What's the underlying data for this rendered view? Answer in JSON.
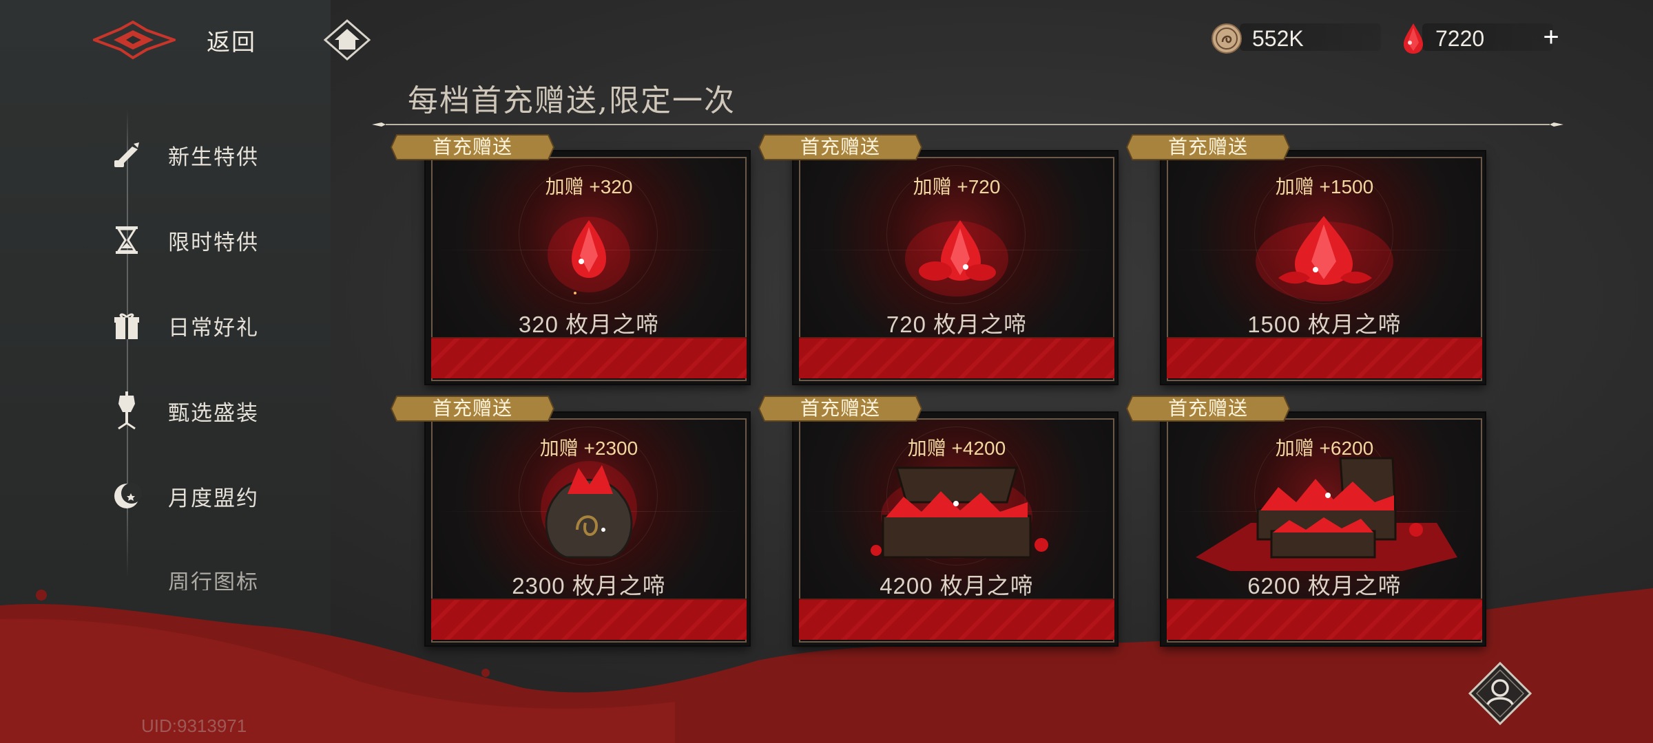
{
  "nav": {
    "back_label": "返回",
    "back_logo_icon": "winged-crest-icon",
    "home_icon": "home-diamond-icon"
  },
  "sidebar": {
    "items": [
      {
        "label": "新生特供",
        "icon": "scroll-quill-icon"
      },
      {
        "label": "限时特供",
        "icon": "hourglass-icon"
      },
      {
        "label": "日常好礼",
        "icon": "gift-box-icon"
      },
      {
        "label": "甄选盛装",
        "icon": "dress-form-icon"
      },
      {
        "label": "月度盟约",
        "icon": "crescent-moon-icon"
      },
      {
        "label": "周行图标",
        "icon": "partial-icon"
      }
    ],
    "uid": "UID:9313971"
  },
  "currencies": {
    "coin_value": "552K",
    "gem_value": "7220",
    "plus_label": "+"
  },
  "shop": {
    "heading": "每档首充赠送,限定一次",
    "ribbon_label": "首充赠送",
    "cards": [
      {
        "bonus": "加赠 +320",
        "amount": "320 枚月之啼",
        "art": "single-gem"
      },
      {
        "bonus": "加赠 +720",
        "amount": "720 枚月之啼",
        "art": "gem-cluster"
      },
      {
        "bonus": "加赠 +1500",
        "amount": "1500 枚月之啼",
        "art": "gem-pile"
      },
      {
        "bonus": "加赠 +2300",
        "amount": "2300 枚月之啼",
        "art": "gem-pouch"
      },
      {
        "bonus": "加赠 +4200",
        "amount": "4200 枚月之啼",
        "art": "gem-chest"
      },
      {
        "bonus": "加赠 +6200",
        "amount": "6200 枚月之啼",
        "art": "double-gem-chest"
      }
    ]
  },
  "colors": {
    "accent_red": "#b3141a",
    "gold_ribbon": "#a8833e",
    "bonus_text": "#f2d7a0"
  }
}
